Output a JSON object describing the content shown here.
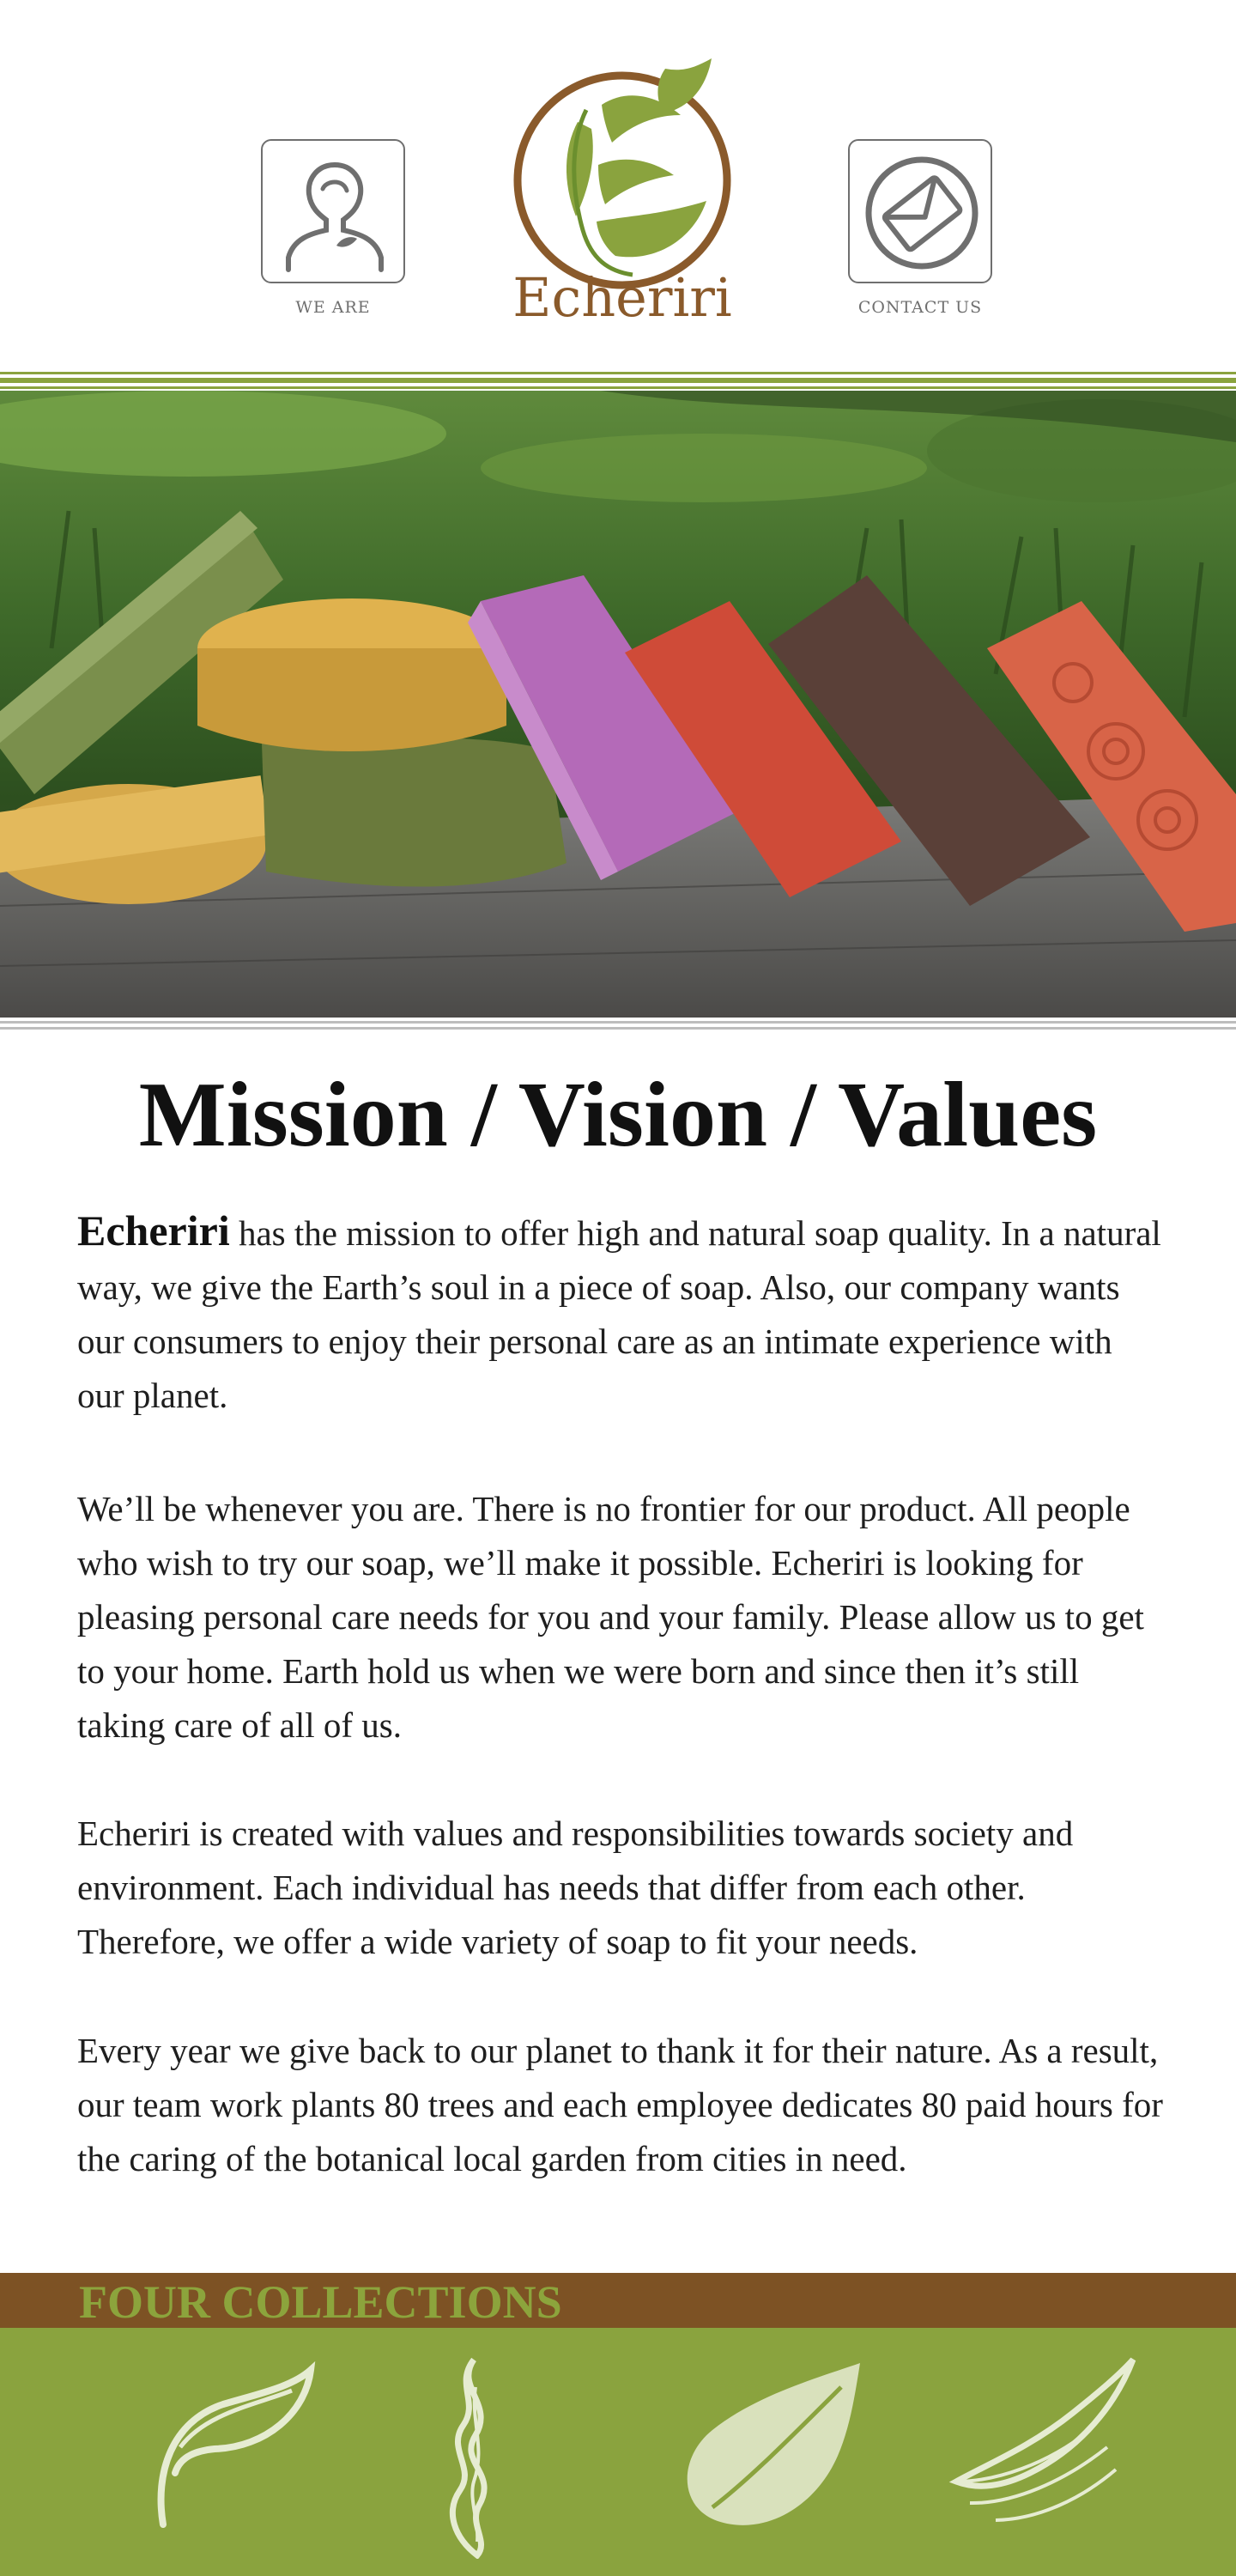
{
  "brand": {
    "name": "Echeriri",
    "colors": {
      "green": "#8aa33e",
      "brown": "#7d5224",
      "grey": "#6f6f6f"
    }
  },
  "nav": {
    "left": {
      "label": "WE ARE",
      "icon": "person-icon"
    },
    "right": {
      "label": "CONTACT US",
      "icon": "envelope-icon"
    }
  },
  "hero": {
    "subject": "soap-bars-photo"
  },
  "main": {
    "title": "Mission / Vision / Values",
    "intro_brand": "Echeriri",
    "paragraph1_rest": " has the mission to offer high and natural soap quality. In a natural way, we give the Earth’s soul in a piece of soap. Also, our company wants our consumers to enjoy their personal care as an intimate experience with our planet.",
    "paragraph2": "We’ll be whenever you are. There is no frontier for our product. All people who wish to try our soap, we’ll make it possible. Echeriri is looking for pleasing personal care needs for you and your family. Please allow us to get to your home. Earth hold us when we were born and since then it’s still taking care of all of us.",
    "paragraph3": "Echeriri is created with values and responsibilities towards society and environment. Each individual has needs that differ from each other. Therefore, we offer a wide variety of soap to fit your needs.",
    "paragraph4": "Every year we give back to our planet to thank it for their nature. As a result, our team work plants 80 trees and each employee dedicates 80 paid hours for the caring of the botanical local garden from cities in need."
  },
  "collections": {
    "label": "FOUR COLLECTIONS",
    "icons": [
      "leaf-sprout-icon",
      "flame-leaf-icon",
      "water-drop-leaf-icon",
      "feather-leaf-icon"
    ]
  }
}
